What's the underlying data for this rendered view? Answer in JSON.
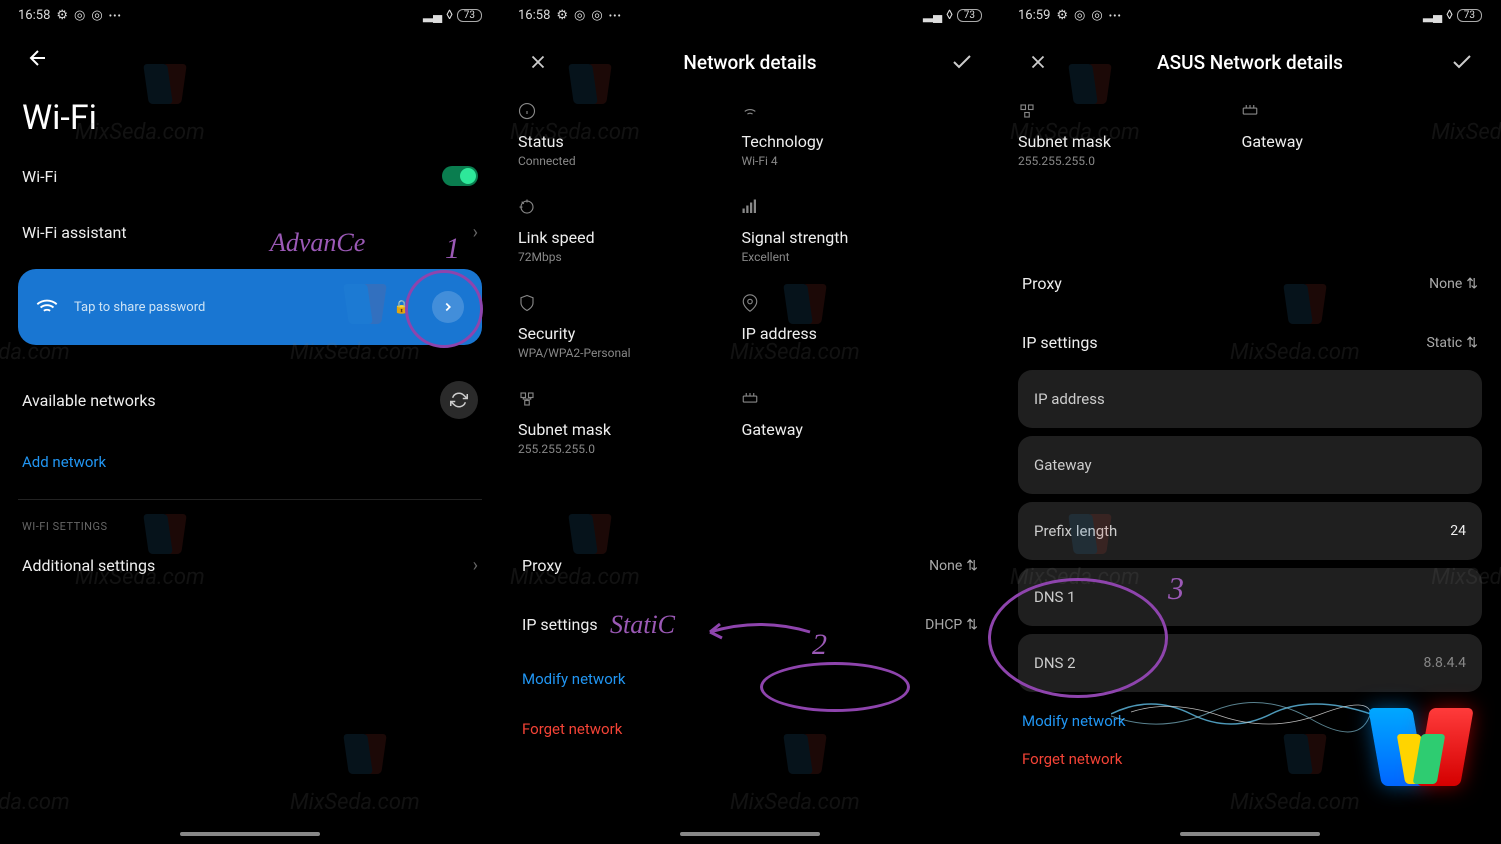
{
  "watermark_text": "MixSeda.com",
  "screen1": {
    "time": "16:58",
    "battery": "73",
    "title": "Wi-Fi",
    "wifi_row": "Wi-Fi",
    "assistant": "Wi-Fi assistant",
    "share_text": "Tap to share password",
    "available": "Available networks",
    "add_network": "Add network",
    "settings_section": "WI-FI SETTINGS",
    "additional": "Additional settings",
    "annotation_text": "AdvanCe",
    "annotation_num": "1"
  },
  "screen2": {
    "time": "16:58",
    "battery": "73",
    "title": "Network details",
    "status": {
      "label": "Status",
      "value": "Connected"
    },
    "technology": {
      "label": "Technology",
      "value": "Wi-Fi 4"
    },
    "link_speed": {
      "label": "Link speed",
      "value": "72Mbps"
    },
    "signal": {
      "label": "Signal strength",
      "value": "Excellent"
    },
    "security": {
      "label": "Security",
      "value": "WPA/WPA2-Personal"
    },
    "ip": {
      "label": "IP address",
      "value": ""
    },
    "subnet": {
      "label": "Subnet mask",
      "value": "255.255.255.0"
    },
    "gateway": {
      "label": "Gateway",
      "value": ""
    },
    "proxy": {
      "label": "Proxy",
      "value": "None"
    },
    "ip_settings": {
      "label": "IP settings",
      "value": "DHCP"
    },
    "modify": "Modify network",
    "forget": "Forget network",
    "annotation_text": "StatiC",
    "annotation_num": "2"
  },
  "screen3": {
    "time": "16:59",
    "battery": "73",
    "title": "ASUS Network details",
    "subnet": {
      "label": "Subnet mask",
      "value": "255.255.255.0"
    },
    "gateway": {
      "label": "Gateway",
      "value": ""
    },
    "proxy": {
      "label": "Proxy",
      "value": "None"
    },
    "ip_settings": {
      "label": "IP settings",
      "value": "Static"
    },
    "fields": {
      "ip": "IP address",
      "gateway": "Gateway",
      "prefix": "Prefix length",
      "prefix_value": "24",
      "dns1": "DNS 1",
      "dns2": "DNS 2",
      "dns2_value": "8.8.4.4"
    },
    "modify": "Modify network",
    "forget": "Forget network",
    "annotation_num": "3"
  }
}
